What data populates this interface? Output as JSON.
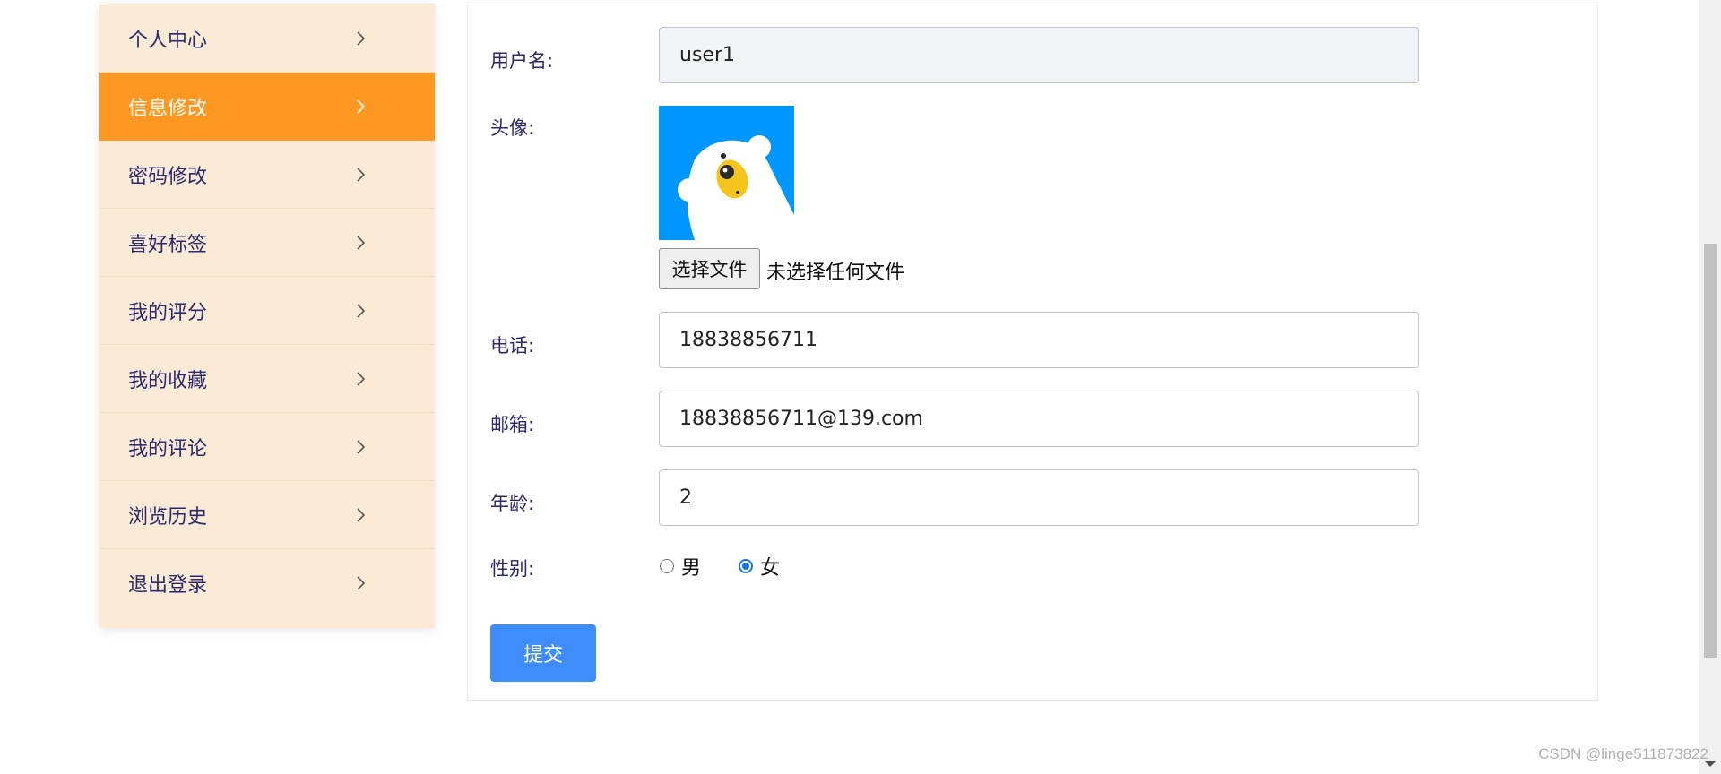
{
  "sidebar": {
    "items": [
      {
        "label": "个人中心",
        "active": false
      },
      {
        "label": "信息修改",
        "active": true
      },
      {
        "label": "密码修改",
        "active": false
      },
      {
        "label": "喜好标签",
        "active": false
      },
      {
        "label": "我的评分",
        "active": false
      },
      {
        "label": "我的收藏",
        "active": false
      },
      {
        "label": "我的评论",
        "active": false
      },
      {
        "label": "浏览历史",
        "active": false
      },
      {
        "label": "退出登录",
        "active": false
      }
    ]
  },
  "form": {
    "username": {
      "label": "用户名:",
      "value": "user1"
    },
    "avatar": {
      "label": "头像:",
      "file_button": "选择文件",
      "file_status": "未选择任何文件"
    },
    "phone": {
      "label": "电话:",
      "value": "18838856711"
    },
    "email": {
      "label": "邮箱:",
      "value": "18838856711@139.com"
    },
    "age": {
      "label": "年龄:",
      "value": "2"
    },
    "gender": {
      "label": "性别:",
      "options": [
        {
          "label": "男",
          "selected": false
        },
        {
          "label": "女",
          "selected": true
        }
      ]
    },
    "submit_label": "提交"
  },
  "watermark": "CSDN @linge511873822",
  "colors": {
    "sidebar_bg": "#fbead6",
    "active_item_bg": "#ff9822",
    "text_primary": "#2b2a6e",
    "submit_bg": "#3f8cff",
    "avatar_bg": "#0096ff"
  },
  "icons": {
    "chevron": "chevron-right-icon",
    "avatar": "bear-avatar"
  }
}
